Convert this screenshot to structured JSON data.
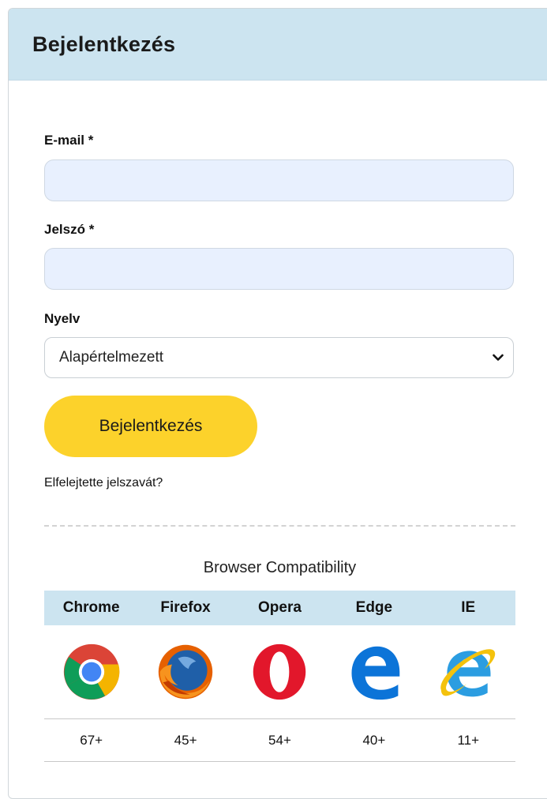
{
  "header": {
    "title": "Bejelentkezés"
  },
  "form": {
    "email_label": "E-mail *",
    "email_value": "",
    "password_label": "Jelszó *",
    "password_value": "",
    "language_label": "Nyelv",
    "language_selected": "Alapértelmezett",
    "login_button": "Bejelentkezés",
    "forgot_link": "Elfelejtette jelszavát?"
  },
  "compatibility": {
    "title": "Browser Compatibility",
    "browsers": [
      {
        "name": "Chrome",
        "version": "67+",
        "icon": "chrome-icon"
      },
      {
        "name": "Firefox",
        "version": "45+",
        "icon": "firefox-icon"
      },
      {
        "name": "Opera",
        "version": "54+",
        "icon": "opera-icon"
      },
      {
        "name": "Edge",
        "version": "40+",
        "icon": "edge-icon"
      },
      {
        "name": "IE",
        "version": "11+",
        "icon": "ie-icon"
      }
    ]
  },
  "colors": {
    "header_bg": "#cce4f0",
    "input_bg": "#e8f0fe",
    "button_bg": "#fcd22b"
  }
}
